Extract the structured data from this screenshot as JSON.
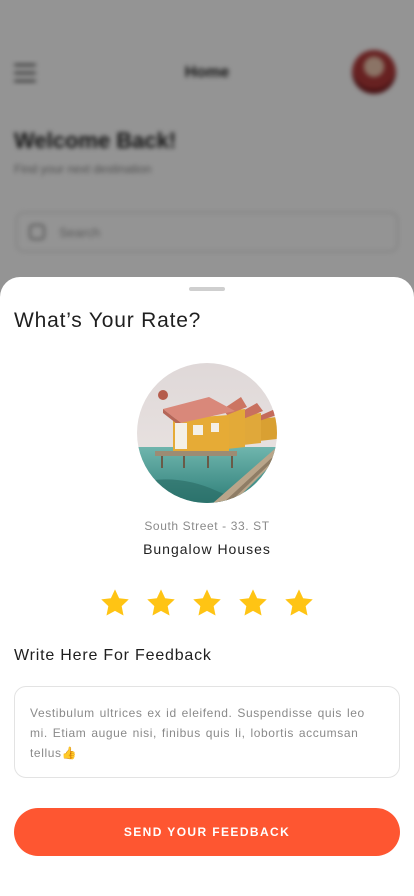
{
  "background": {
    "header_title": "Home",
    "welcome": "Welcome Back!",
    "subtitle": "Find your next destination",
    "search_placeholder": "Search"
  },
  "rating_sheet": {
    "title": "What’s Your Rate?",
    "place": {
      "address": "South Street - 33. ST",
      "name": "Bungalow Houses"
    },
    "rating": {
      "value": 5,
      "max": 5
    },
    "feedback_label": "Write Here For Feedback",
    "feedback_text": "Vestibulum ultrices ex id  eleifend. Suspendisse quis leo mi. Etiam augue nisi, finibus quis li, lobortis accumsan tellus👍",
    "send_button": "SEND YOUR FEEDBACK"
  },
  "colors": {
    "accent": "#fe5631",
    "star": "#ffc414",
    "overlay": "#000000"
  },
  "icons": [
    "menu-icon",
    "search-icon",
    "star-icon"
  ]
}
